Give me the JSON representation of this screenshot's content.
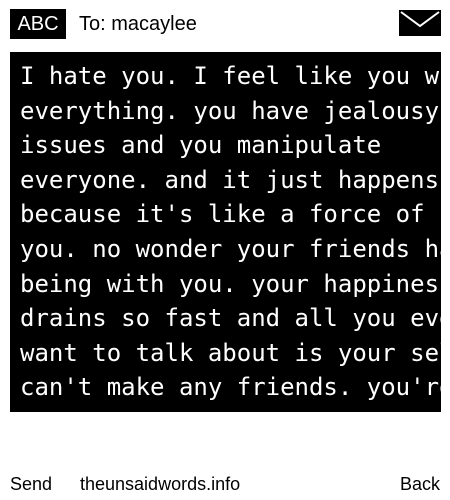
{
  "header": {
    "badge": "ABC",
    "recipient": "To: macaylee",
    "icon": "envelope-icon"
  },
  "message": {
    "lines": [
      "I hate you. I feel like you wreck",
      "everything. you have jealousy",
      "issues and you manipulate",
      "everyone. and it just happens",
      "because it's like a force of habit for",
      "you. no wonder your friends hate",
      "being with you. your happiness",
      "drains so fast and all you ever",
      "want to talk about is your self. you",
      "can't make any friends. you're"
    ]
  },
  "footer": {
    "send_label": "Send",
    "site_label": "theunsaidwords.info",
    "back_label": "Back"
  },
  "colors": {
    "background": "#ffffff",
    "foreground": "#000000",
    "inverse_text": "#ffffff"
  }
}
